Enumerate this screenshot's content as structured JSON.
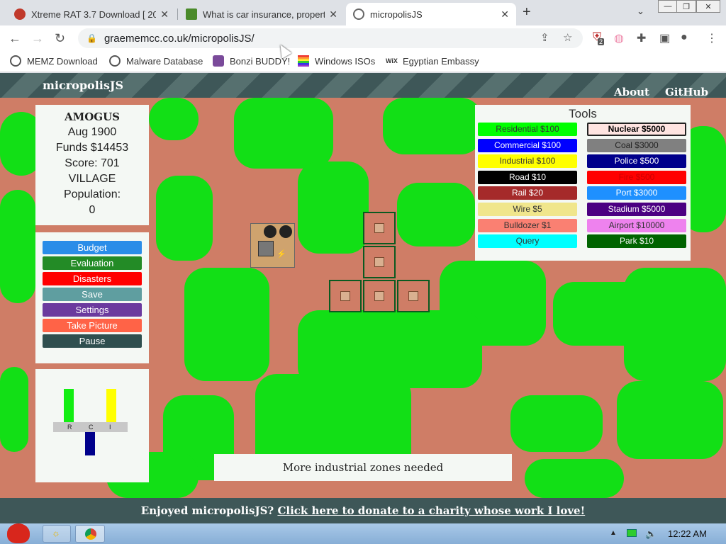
{
  "browser": {
    "tabs": [
      {
        "label": "Xtreme RAT 3.7 Download [ 20",
        "active": false
      },
      {
        "label": "What is car insurance, propert",
        "active": false
      },
      {
        "label": "micropolisJS",
        "active": true
      }
    ],
    "url": "graememcc.co.uk/micropolisJS/",
    "bookmarks": [
      "MEMZ Download",
      "Malware Database",
      "Bonzi BUDDY!",
      "Windows ISOs",
      "Egyptian Embassy"
    ],
    "extension_badge": "2"
  },
  "header": {
    "logo": "micropolisJS",
    "links": [
      "About",
      "GitHub"
    ]
  },
  "info": {
    "city_name": "AMOGUS",
    "date": "Aug 1900",
    "funds": "Funds $14453",
    "score": "Score: 701",
    "class": "VILLAGE",
    "population_label": "Population:",
    "population": "0"
  },
  "menu": {
    "buttons": [
      {
        "label": "Budget",
        "color": "#2a8de8"
      },
      {
        "label": "Evaluation",
        "color": "#238b26"
      },
      {
        "label": "Disasters",
        "color": "#ff0000"
      },
      {
        "label": "Save",
        "color": "#5f9ea0"
      },
      {
        "label": "Settings",
        "color": "#6b3a9e"
      },
      {
        "label": "Take Picture",
        "color": "#ff6347"
      },
      {
        "label": "Pause",
        "color": "#2f4f4f"
      }
    ]
  },
  "rci": {
    "labels": [
      "R",
      "C",
      "I"
    ],
    "residential": 0.47,
    "commercial": -0.33,
    "industrial": 0.47
  },
  "tools": {
    "title": "Tools",
    "items": [
      {
        "label": "Residential $100",
        "bg": "#00ff00",
        "fg": "#333333"
      },
      {
        "label": "Nuclear $5000",
        "bg": "#ffe4e1",
        "fg": "#000000"
      },
      {
        "label": "Commercial $100",
        "bg": "#0000ff",
        "fg": "#ffffff"
      },
      {
        "label": "Coal $3000",
        "bg": "#808080",
        "fg": "#222222"
      },
      {
        "label": "Industrial $100",
        "bg": "#ffff00",
        "fg": "#333333"
      },
      {
        "label": "Police $500",
        "bg": "#00008b",
        "fg": "#ffffff"
      },
      {
        "label": "Road $10",
        "bg": "#000000",
        "fg": "#ffffff"
      },
      {
        "label": "Fire $500",
        "bg": "#ff0000",
        "fg": "#cc0000"
      },
      {
        "label": "Rail $20",
        "bg": "#a52a2a",
        "fg": "#ffffff"
      },
      {
        "label": "Port $3000",
        "bg": "#1e90ff",
        "fg": "#ffffff"
      },
      {
        "label": "Wire $5",
        "bg": "#f0e68c",
        "fg": "#333333"
      },
      {
        "label": "Stadium $5000",
        "bg": "#4b0082",
        "fg": "#ffffff"
      },
      {
        "label": "Bulldozer $1",
        "bg": "#fa8072",
        "fg": "#333333"
      },
      {
        "label": "Airport $10000",
        "bg": "#ee82ee",
        "fg": "#333333"
      },
      {
        "label": "Query",
        "bg": "#00ffff",
        "fg": "#333333"
      },
      {
        "label": "Park $10",
        "bg": "#006400",
        "fg": "#ffffff"
      }
    ],
    "selected": "Nuclear $5000"
  },
  "message": "More industrial zones needed",
  "footer": {
    "prefix": "Enjoyed micropolisJS?",
    "link": "Click here to donate to a charity whose work I love!"
  },
  "taskbar": {
    "clock": "12:22 AM"
  },
  "icons": {
    "tab1": "sheikh-favicon-icon",
    "tab2": "green-document-icon",
    "tab3": "globe-icon"
  }
}
